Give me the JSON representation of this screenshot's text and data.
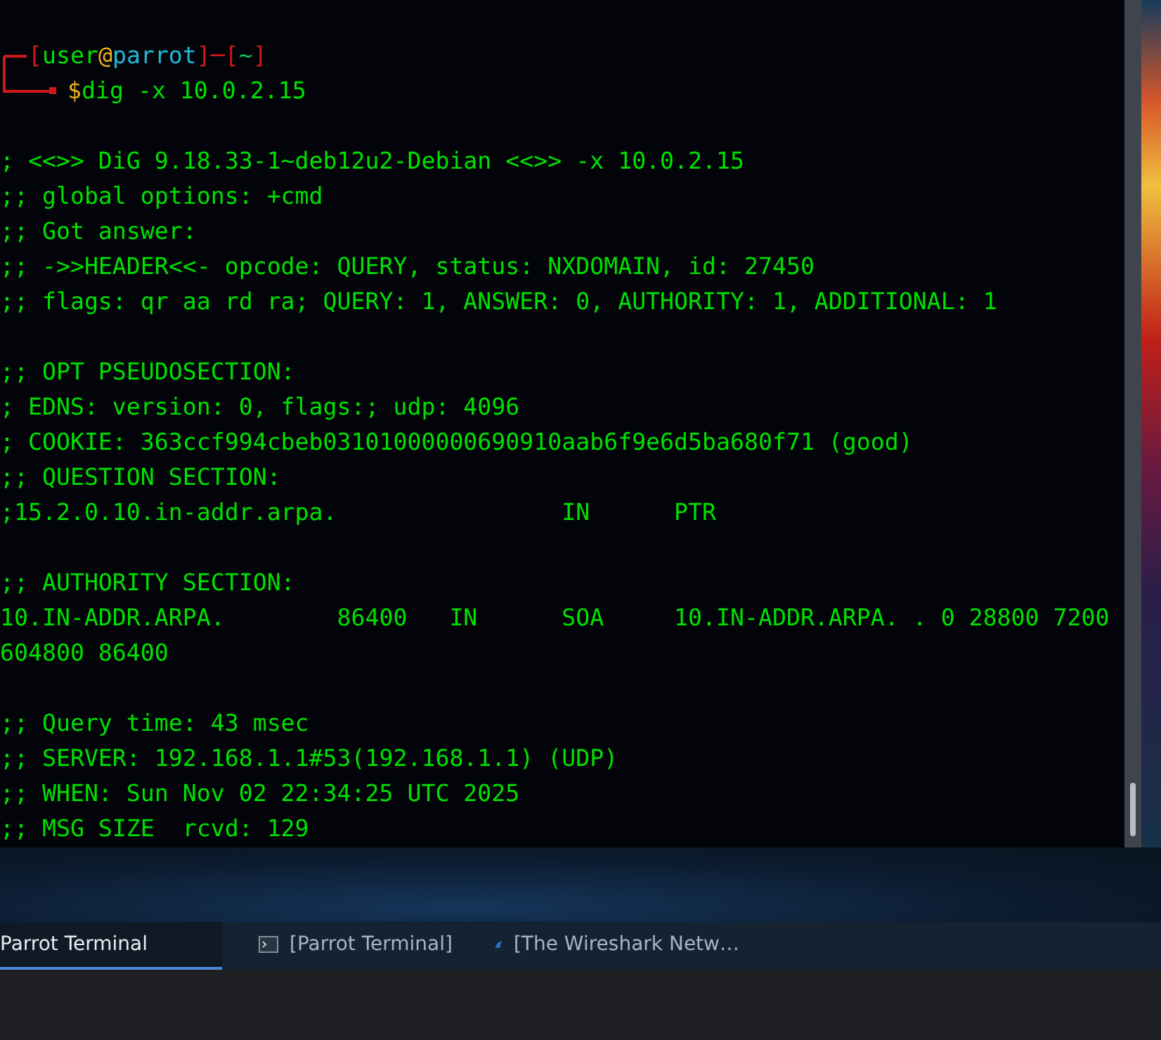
{
  "terminal": {
    "prompt": [
      {
        "kind": "bracket",
        "text": "["
      },
      {
        "kind": "user",
        "text": "user"
      },
      {
        "kind": "at",
        "text": "@"
      },
      {
        "kind": "host",
        "text": "parrot"
      },
      {
        "kind": "bracket",
        "text": "]─["
      },
      {
        "kind": "dir",
        "text": "~"
      },
      {
        "kind": "bracket",
        "text": "]"
      }
    ],
    "command": {
      "sigil": "$",
      "text": "dig -x 10.0.2.15"
    },
    "output_blocks": [
      [
        "; <<>> DiG 9.18.33-1~deb12u2-Debian <<>> -x 10.0.2.15",
        ";; global options: +cmd",
        ";; Got answer:",
        ";; ->>HEADER<<- opcode: QUERY, status: NXDOMAIN, id: 27450",
        ";; flags: qr aa rd ra; QUERY: 1, ANSWER: 0, AUTHORITY: 1, ADDITIONAL: 1"
      ],
      [
        ";; OPT PSEUDOSECTION:",
        "; EDNS: version: 0, flags:; udp: 4096",
        "; COOKIE: 363ccf994cbeb03101000000690910aab6f9e6d5ba680f71 (good)",
        ";; QUESTION SECTION:",
        ";15.2.0.10.in-addr.arpa.                IN      PTR"
      ],
      [
        ";; AUTHORITY SECTION:",
        "10.IN-ADDR.ARPA.        86400   IN      SOA     10.IN-ADDR.ARPA. . 0 28800 7200",
        "604800 86400"
      ],
      [
        ";; Query time: 43 msec",
        ";; SERVER: 192.168.1.1#53(192.168.1.1) (UDP)",
        ";; WHEN: Sun Nov 02 22:34:25 UTC 2025",
        ";; MSG SIZE  rcvd: 129"
      ]
    ]
  },
  "taskbar": {
    "items": [
      {
        "kind": "plain",
        "label": "Parrot Terminal",
        "selected": true
      },
      {
        "kind": "terminal",
        "label": "[Parrot Terminal]",
        "selected": false
      },
      {
        "kind": "wireshark",
        "label": "[The Wireshark Netw…",
        "selected": false
      }
    ]
  }
}
